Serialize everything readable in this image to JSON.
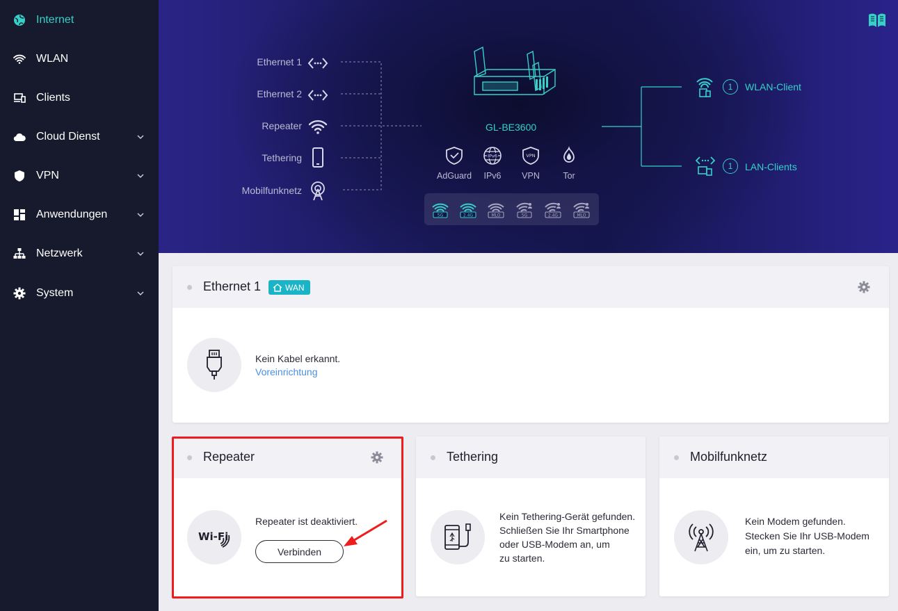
{
  "sidebar": {
    "items": [
      {
        "label": "Internet",
        "icon": "globe-icon",
        "active": true
      },
      {
        "label": "WLAN",
        "icon": "wifi-icon"
      },
      {
        "label": "Clients",
        "icon": "devices-icon"
      },
      {
        "label": "Cloud Dienst",
        "icon": "cloud-icon",
        "expandable": true
      },
      {
        "label": "VPN",
        "icon": "shield-icon",
        "expandable": true
      },
      {
        "label": "Anwendungen",
        "icon": "apps-grid-icon",
        "expandable": true
      },
      {
        "label": "Netzwerk",
        "icon": "network-tree-icon",
        "expandable": true
      },
      {
        "label": "System",
        "icon": "gear-icon",
        "expandable": true
      }
    ]
  },
  "topology": {
    "sources": [
      {
        "label": "Ethernet 1",
        "icon": "ethernet-port-icon"
      },
      {
        "label": "Ethernet 2",
        "icon": "ethernet-port-icon"
      },
      {
        "label": "Repeater",
        "icon": "wifi-icon"
      },
      {
        "label": "Tethering",
        "icon": "phone-icon"
      },
      {
        "label": "Mobilfunknetz",
        "icon": "cell-tower-icon"
      }
    ],
    "router_name": "GL-BE3600",
    "services": [
      {
        "label": "AdGuard",
        "icon": "adguard-shield-icon"
      },
      {
        "label": "IPv6",
        "icon": "ipv6-globe-icon"
      },
      {
        "label": "VPN",
        "icon": "vpn-shield-icon"
      },
      {
        "label": "Tor",
        "icon": "tor-onion-icon"
      }
    ],
    "bands": [
      {
        "label": "5G",
        "active": true,
        "type": "wifi"
      },
      {
        "label": "2.4G",
        "active": true,
        "type": "wifi"
      },
      {
        "label": "MLO",
        "active": false,
        "type": "wifi"
      },
      {
        "label": "5G",
        "active": false,
        "type": "guest"
      },
      {
        "label": "2.4G",
        "active": false,
        "type": "guest"
      },
      {
        "label": "MLO",
        "active": false,
        "type": "guest"
      }
    ],
    "clients": [
      {
        "count": "1",
        "label": "WLAN-Client",
        "icon": "wlan-client-icon"
      },
      {
        "count": "1",
        "label": "LAN-Clients",
        "icon": "lan-client-icon"
      }
    ]
  },
  "cards": {
    "ethernet": {
      "title": "Ethernet 1",
      "badge": "WAN",
      "message": "Kein Kabel erkannt.",
      "link": "Voreinrichtung"
    },
    "repeater": {
      "title": "Repeater",
      "message": "Repeater ist deaktiviert.",
      "button": "Verbinden",
      "icon_text": "Wi-Fi"
    },
    "tethering": {
      "title": "Tethering",
      "message": [
        "Kein Tethering-Gerät gefunden.",
        "Schließen Sie Ihr Smartphone",
        "oder USB-Modem an, um",
        "zu starten."
      ]
    },
    "mobile": {
      "title": "Mobilfunknetz",
      "message": [
        "Kein Modem gefunden.",
        "Stecken Sie Ihr USB-Modem",
        "ein, um zu starten."
      ]
    }
  },
  "colors": {
    "accent": "#36d0c8",
    "sidebar_bg": "#171a2c",
    "link": "#4a8fe0",
    "highlight": "#ee1c1c",
    "badge": "#1bb3c6"
  }
}
